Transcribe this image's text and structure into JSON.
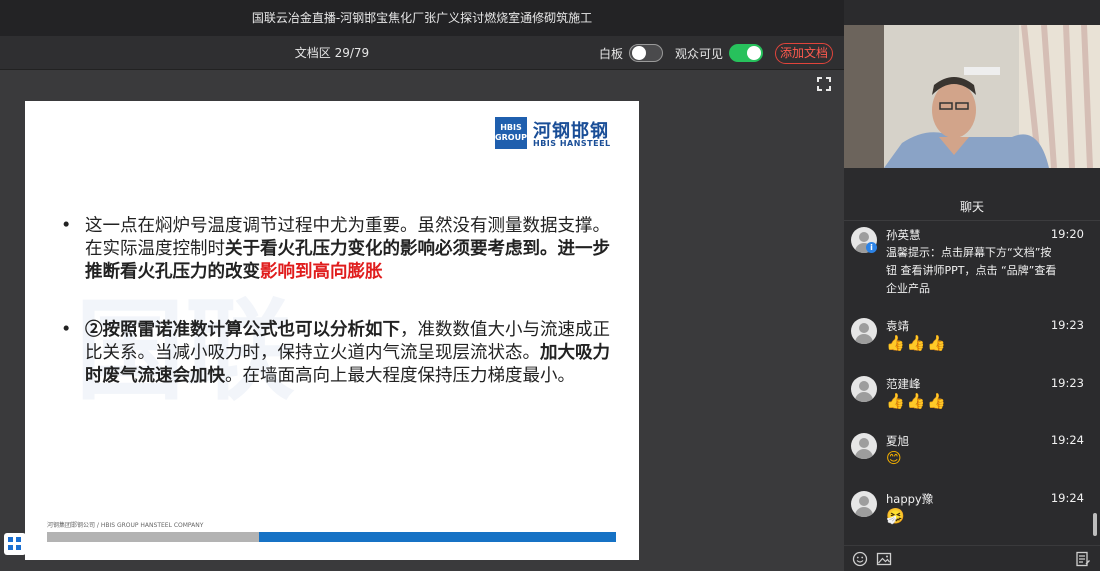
{
  "window": {
    "title": "国联云冶金直播-河钢邯宝焦化厂张广义探讨燃烧室通修砌筑施工"
  },
  "docbar": {
    "page_indicator": "文档区 29/79",
    "whiteboard_label": "白板",
    "whiteboard_on": false,
    "audience_visible_label": "观众可见",
    "audience_visible_on": true,
    "add_doc_label": "添加文档"
  },
  "slide": {
    "logo": {
      "box_text": "HBIS GROUP",
      "cn": "河钢邯钢",
      "en": "HBIS HANSTEEL"
    },
    "bullet1": {
      "t1": "这一点在焖炉号温度调节过程中尤为重要。虽然没有测量数据支撑。在实际温度控制时",
      "t2": "关于看火孔压力变化的影响必须要考虑到。进一步推断看火孔压力的改变",
      "t3": "影响到高向膨胀"
    },
    "bullet2": {
      "t1": "②按照雷诺准数计算公式也可以分析如下",
      "t2": "，准数数值大小与流速成正比关系。当减小吸力时，保持立火道内气流呈现层流状态。",
      "t3": "加大吸力时废气流速会加快",
      "t4": "。在墙面高向上最大程度保持压力梯度最小。"
    },
    "footer": "河钢集团邯钢公司 / HBIS GROUP HANSTEEL COMPANY",
    "watermark": "国联"
  },
  "chat": {
    "title": "聊天",
    "messages": [
      {
        "name": "孙英慧",
        "time": "19:20",
        "text": "温馨提示：点击屏幕下方“文档”按钮 查看讲师PPT，点击 “品牌”查看企业产品"
      },
      {
        "name": "袁靖",
        "time": "19:23",
        "text": "👍👍👍"
      },
      {
        "name": "范建峰",
        "time": "19:23",
        "text": "👍👍👍"
      },
      {
        "name": "夏旭",
        "time": "19:24",
        "text": "😊"
      },
      {
        "name": "happy豫",
        "time": "19:24",
        "text": "🤧"
      }
    ]
  },
  "icons": [
    "fullscreen-icon",
    "grid-icon",
    "emoji-icon",
    "image-icon",
    "notes-icon"
  ],
  "colors": {
    "accent_green": "#27c15c",
    "add_doc_red": "#ff5a4f",
    "brand_blue": "#1672c5"
  }
}
